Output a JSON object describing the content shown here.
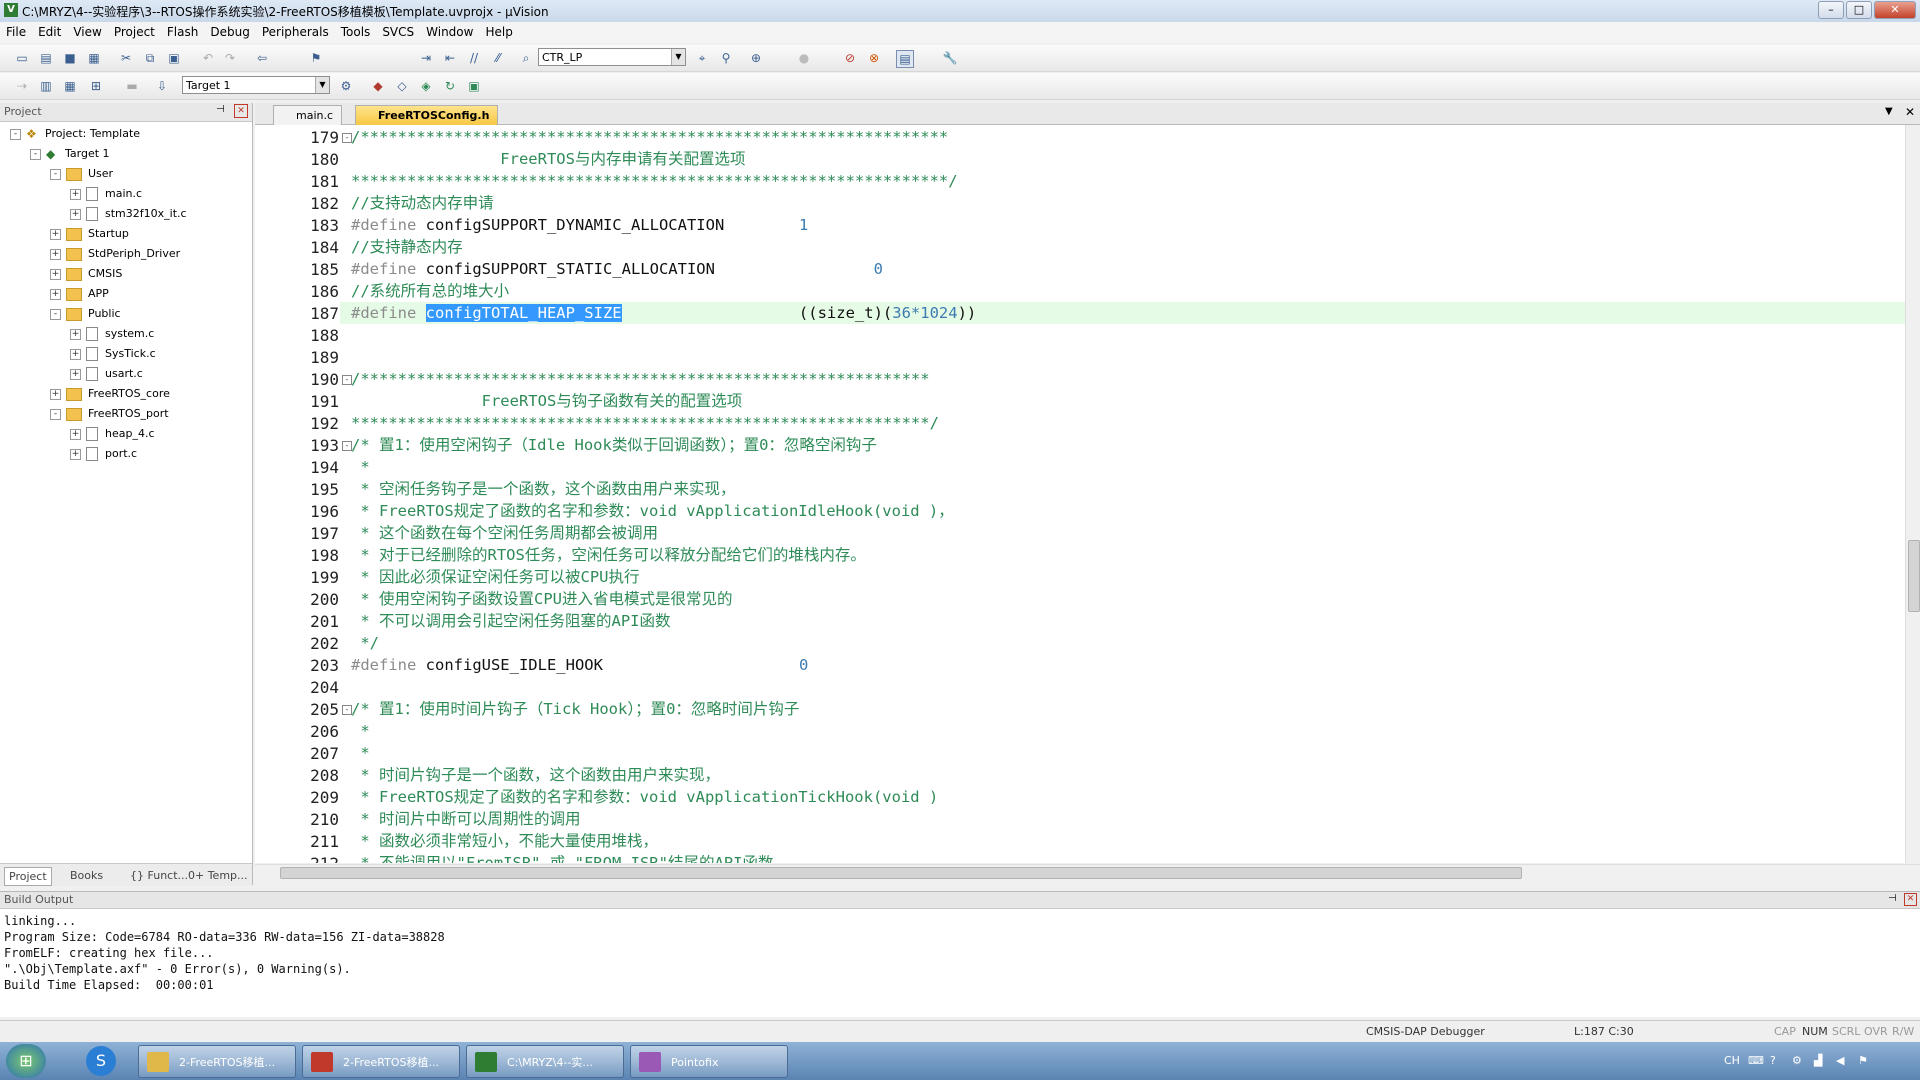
{
  "window": {
    "title": "C:\\MRYZ\\4--实验程序\\3--RTOS操作系统实验\\2-FreeRTOS移植模板\\Template.uvprojx - µVision",
    "app_icon": "V"
  },
  "menu": [
    "File",
    "Edit",
    "View",
    "Project",
    "Flash",
    "Debug",
    "Peripherals",
    "Tools",
    "SVCS",
    "Window",
    "Help"
  ],
  "toolbar": {
    "search_combo": "CTR_LP",
    "target_combo": "Target 1"
  },
  "project_panel": {
    "header": "Project",
    "tree": [
      {
        "label": "Project: Template",
        "level": 0,
        "type": "project",
        "toggle": "-"
      },
      {
        "label": "Target 1",
        "level": 1,
        "type": "target",
        "toggle": "-"
      },
      {
        "label": "User",
        "level": 2,
        "type": "folder",
        "toggle": "-"
      },
      {
        "label": "main.c",
        "level": 3,
        "type": "file",
        "toggle": "+"
      },
      {
        "label": "stm32f10x_it.c",
        "level": 3,
        "type": "file",
        "toggle": "+"
      },
      {
        "label": "Startup",
        "level": 2,
        "type": "folder",
        "toggle": "+"
      },
      {
        "label": "StdPeriph_Driver",
        "level": 2,
        "type": "folder",
        "toggle": "+"
      },
      {
        "label": "CMSIS",
        "level": 2,
        "type": "folder",
        "toggle": "+"
      },
      {
        "label": "APP",
        "level": 2,
        "type": "folder",
        "toggle": "+"
      },
      {
        "label": "Public",
        "level": 2,
        "type": "folder",
        "toggle": "-"
      },
      {
        "label": "system.c",
        "level": 3,
        "type": "file",
        "toggle": "+"
      },
      {
        "label": "SysTick.c",
        "level": 3,
        "type": "file",
        "toggle": "+"
      },
      {
        "label": "usart.c",
        "level": 3,
        "type": "file",
        "toggle": "+"
      },
      {
        "label": "FreeRTOS_core",
        "level": 2,
        "type": "folder",
        "toggle": "+"
      },
      {
        "label": "FreeRTOS_port",
        "level": 2,
        "type": "folder",
        "toggle": "-"
      },
      {
        "label": "heap_4.c",
        "level": 3,
        "type": "file",
        "toggle": "+"
      },
      {
        "label": "port.c",
        "level": 3,
        "type": "file",
        "toggle": "+"
      }
    ],
    "tabs": [
      "Project",
      "Books",
      "{} Funct...",
      "0+ Temp..."
    ]
  },
  "editor": {
    "tabs": [
      {
        "label": "main.c",
        "active": false
      },
      {
        "label": "FreeRTOSConfig.h",
        "active": true
      }
    ],
    "lines": [
      {
        "n": "179",
        "fold": "-",
        "segs": [
          {
            "c": "cmt",
            "t": "/***************************************************************"
          }
        ]
      },
      {
        "n": "180",
        "segs": [
          {
            "c": "cmt",
            "t": "                FreeRTOS与内存申请有关配置选项"
          }
        ]
      },
      {
        "n": "181",
        "segs": [
          {
            "c": "cmt",
            "t": "****************************************************************/"
          }
        ]
      },
      {
        "n": "182",
        "segs": [
          {
            "c": "cmt",
            "t": "//支持动态内存申请"
          }
        ]
      },
      {
        "n": "183",
        "segs": [
          {
            "c": "kw",
            "t": "#define "
          },
          {
            "c": "plain",
            "t": "configSUPPORT_DYNAMIC_ALLOCATION        "
          },
          {
            "c": "num",
            "t": "1"
          }
        ]
      },
      {
        "n": "184",
        "segs": [
          {
            "c": "cmt",
            "t": "//支持静态内存"
          }
        ]
      },
      {
        "n": "185",
        "segs": [
          {
            "c": "kw",
            "t": "#define "
          },
          {
            "c": "plain",
            "t": "configSUPPORT_STATIC_ALLOCATION                 "
          },
          {
            "c": "num",
            "t": "0"
          }
        ]
      },
      {
        "n": "186",
        "segs": [
          {
            "c": "cmt",
            "t": "//系统所有总的堆大小"
          }
        ]
      },
      {
        "n": "187",
        "hl": true,
        "segs": [
          {
            "c": "kw",
            "t": "#define "
          },
          {
            "c": "sel",
            "t": "configTOTAL_HEAP_SIZE"
          },
          {
            "c": "plain",
            "t": "                   ((size_t)("
          },
          {
            "c": "num",
            "t": "36*1024"
          },
          {
            "c": "plain",
            "t": "))"
          }
        ]
      },
      {
        "n": "188",
        "segs": []
      },
      {
        "n": "189",
        "segs": []
      },
      {
        "n": "190",
        "fold": "-",
        "segs": [
          {
            "c": "cmt",
            "t": "/*************************************************************"
          }
        ]
      },
      {
        "n": "191",
        "segs": [
          {
            "c": "cmt",
            "t": "              FreeRTOS与钩子函数有关的配置选项"
          }
        ]
      },
      {
        "n": "192",
        "segs": [
          {
            "c": "cmt",
            "t": "**************************************************************/"
          }
        ]
      },
      {
        "n": "193",
        "fold": "-",
        "segs": [
          {
            "c": "cmt",
            "t": "/* 置1：使用空闲钩子（Idle Hook类似于回调函数）；置0：忽略空闲钩子"
          }
        ]
      },
      {
        "n": "194",
        "segs": [
          {
            "c": "cmt",
            "t": " *"
          }
        ]
      },
      {
        "n": "195",
        "segs": [
          {
            "c": "cmt",
            "t": " * 空闲任务钩子是一个函数，这个函数由用户来实现，"
          }
        ]
      },
      {
        "n": "196",
        "segs": [
          {
            "c": "cmt",
            "t": " * FreeRTOS规定了函数的名字和参数：void vApplicationIdleHook(void )，"
          }
        ]
      },
      {
        "n": "197",
        "segs": [
          {
            "c": "cmt",
            "t": " * 这个函数在每个空闲任务周期都会被调用"
          }
        ]
      },
      {
        "n": "198",
        "segs": [
          {
            "c": "cmt",
            "t": " * 对于已经删除的RTOS任务，空闲任务可以释放分配给它们的堆栈内存。"
          }
        ]
      },
      {
        "n": "199",
        "segs": [
          {
            "c": "cmt",
            "t": " * 因此必须保证空闲任务可以被CPU执行"
          }
        ]
      },
      {
        "n": "200",
        "segs": [
          {
            "c": "cmt",
            "t": " * 使用空闲钩子函数设置CPU进入省电模式是很常见的"
          }
        ]
      },
      {
        "n": "201",
        "segs": [
          {
            "c": "cmt",
            "t": " * 不可以调用会引起空闲任务阻塞的API函数"
          }
        ]
      },
      {
        "n": "202",
        "segs": [
          {
            "c": "cmt",
            "t": " */"
          }
        ]
      },
      {
        "n": "203",
        "segs": [
          {
            "c": "kw",
            "t": "#define "
          },
          {
            "c": "plain",
            "t": "configUSE_IDLE_HOOK                     "
          },
          {
            "c": "num",
            "t": "0"
          }
        ]
      },
      {
        "n": "204",
        "segs": []
      },
      {
        "n": "205",
        "fold": "-",
        "segs": [
          {
            "c": "cmt",
            "t": "/* 置1：使用时间片钩子（Tick Hook）；置0：忽略时间片钩子"
          }
        ]
      },
      {
        "n": "206",
        "segs": [
          {
            "c": "cmt",
            "t": " *"
          }
        ]
      },
      {
        "n": "207",
        "segs": [
          {
            "c": "cmt",
            "t": " *"
          }
        ]
      },
      {
        "n": "208",
        "segs": [
          {
            "c": "cmt",
            "t": " * 时间片钩子是一个函数，这个函数由用户来实现，"
          }
        ]
      },
      {
        "n": "209",
        "segs": [
          {
            "c": "cmt",
            "t": " * FreeRTOS规定了函数的名字和参数：void vApplicationTickHook(void )"
          }
        ]
      },
      {
        "n": "210",
        "segs": [
          {
            "c": "cmt",
            "t": " * 时间片中断可以周期性的调用"
          }
        ]
      },
      {
        "n": "211",
        "segs": [
          {
            "c": "cmt",
            "t": " * 函数必须非常短小，不能大量使用堆栈，"
          }
        ]
      },
      {
        "n": "212",
        "segs": [
          {
            "c": "cmt",
            "t": " * 不能调用以\"FromISR\" 或 \"FROM_ISR\"结尾的API函数"
          }
        ]
      }
    ]
  },
  "build_output": {
    "title": "Build Output",
    "lines": [
      "linking...",
      "Program Size: Code=6784 RO-data=336 RW-data=156 ZI-data=38828",
      "FromELF: creating hex file...",
      "\".\\Obj\\Template.axf\" - 0 Error(s), 0 Warning(s).",
      "Build Time Elapsed:  00:00:01"
    ]
  },
  "statusbar": {
    "debugger": "CMSIS-DAP Debugger",
    "position": "L:187 C:30",
    "cap": "CAP",
    "num": "NUM",
    "scrl": "SCRL",
    "ovr": "OVR",
    "rw": "R/W"
  },
  "taskbar": {
    "apps": [
      {
        "label": "2-FreeRTOS移植...",
        "color": "#e0b84a"
      },
      {
        "label": "2-FreeRTOS移植...",
        "color": "#c0392b"
      },
      {
        "label": "C:\\MRYZ\\4--实...",
        "color": "#2e7d32"
      },
      {
        "label": "Pointofix",
        "color": "#9b59b6"
      }
    ],
    "tray_lang": "CH"
  }
}
